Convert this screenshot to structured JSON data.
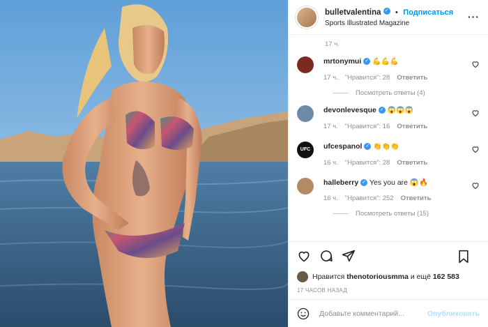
{
  "post": {
    "author": "bulletvalentina",
    "follow_label": "Подписаться",
    "separator": "•",
    "location": "Sports Illustrated Magazine",
    "more_label": "···"
  },
  "caption_time": "17 ч.",
  "comments": [
    {
      "user": "mrtonymui",
      "text": "💪💪💪",
      "time": "17 ч.",
      "likes": "\"Нравится\": 28",
      "reply": "Ответить",
      "replies": "Посмотреть ответы (4)",
      "verified": true,
      "avatar_color": "#7a2a1e"
    },
    {
      "user": "devonlevesque",
      "text": "😱😱😱",
      "time": "17 ч.",
      "likes": "\"Нравится\": 16",
      "reply": "Ответить",
      "replies": "",
      "verified": true,
      "avatar_color": "#6f8aa8"
    },
    {
      "user": "ufcespanol",
      "text": "👏👏👏",
      "time": "16 ч.",
      "likes": "\"Нравится\": 28",
      "reply": "Ответить",
      "replies": "",
      "verified": true,
      "avatar_color": "#111111",
      "avatar_text": "UFC"
    },
    {
      "user": "halleberry",
      "text": "Yes you are 😱🔥",
      "time": "16 ч.",
      "likes": "\"Нравится\": 252",
      "reply": "Ответить",
      "replies": "Посмотреть ответы (15)",
      "verified": true,
      "avatar_color": "#b48a62"
    }
  ],
  "likes_line": {
    "prefix": "Нравится",
    "user": "thenotoriousmma",
    "middle": "и ещё",
    "count": "162 583"
  },
  "post_time": "17 ЧАСОВ НАЗАД",
  "add_comment": {
    "placeholder": "Добавьте комментарий...",
    "publish": "Опубликовать"
  },
  "colors": {
    "link": "#0095f6",
    "muted": "#8e8e8e",
    "verified": "#3897f0"
  }
}
